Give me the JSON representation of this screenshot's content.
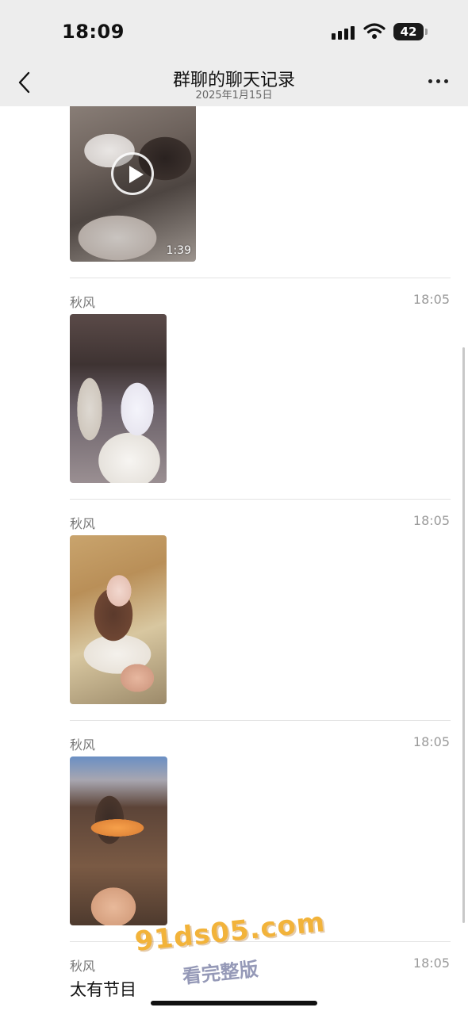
{
  "status_bar": {
    "time": "18:09",
    "battery": "42"
  },
  "nav": {
    "title": "群聊的聊天记录",
    "subtitle": "2025年1月15日"
  },
  "video": {
    "duration": "1:39"
  },
  "messages": [
    {
      "sender": "秋风",
      "time": "18:05",
      "type": "image"
    },
    {
      "sender": "秋风",
      "time": "18:05",
      "type": "image"
    },
    {
      "sender": "秋风",
      "time": "18:05",
      "type": "image"
    },
    {
      "sender": "秋风",
      "time": "18:05",
      "type": "text",
      "text": "太有节目"
    }
  ],
  "watermark": {
    "url": "91ds05.com",
    "caption": "看完整版"
  },
  "icons": {
    "back": "chevron-left-icon",
    "more": "more-horizontal-icon",
    "play": "play-icon",
    "signal": "cellular-signal-icon",
    "wifi": "wifi-icon",
    "battery": "battery-icon"
  }
}
